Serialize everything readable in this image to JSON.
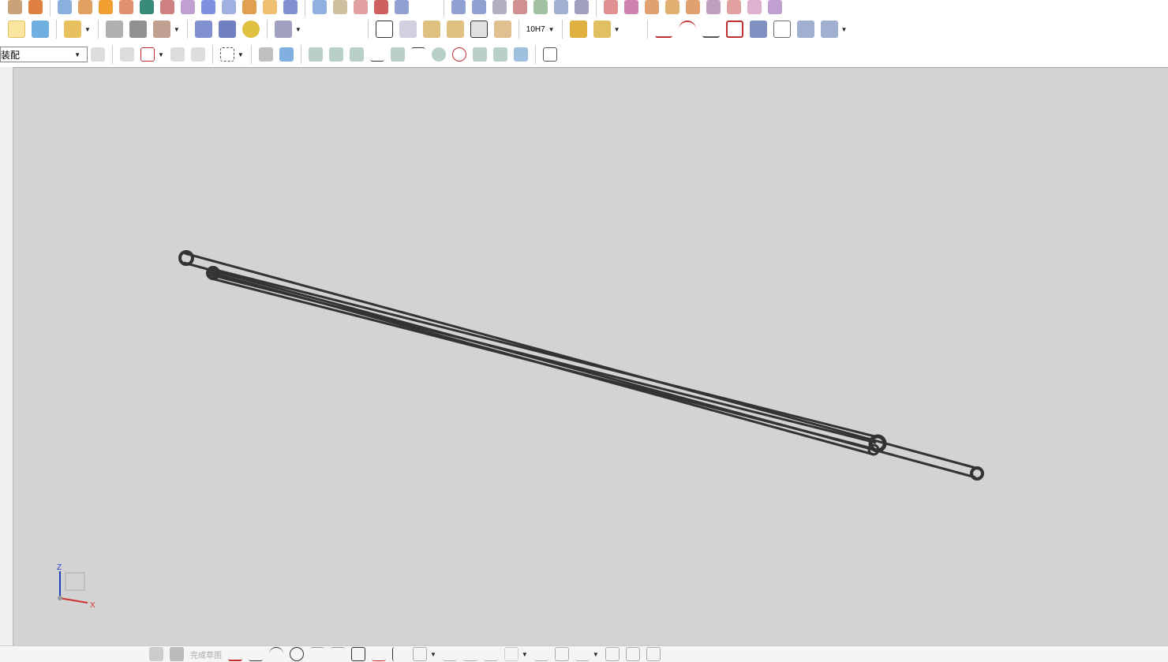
{
  "toolbar": {
    "assembly_combo": "装配",
    "tolerance_label": "10H7"
  },
  "sketch_bar": {
    "finish_sketch": "完成草图"
  },
  "triad": {
    "z": "Z",
    "x": "X"
  },
  "colors": {
    "viewport": "#d3d3d3",
    "belt": "#333333"
  }
}
